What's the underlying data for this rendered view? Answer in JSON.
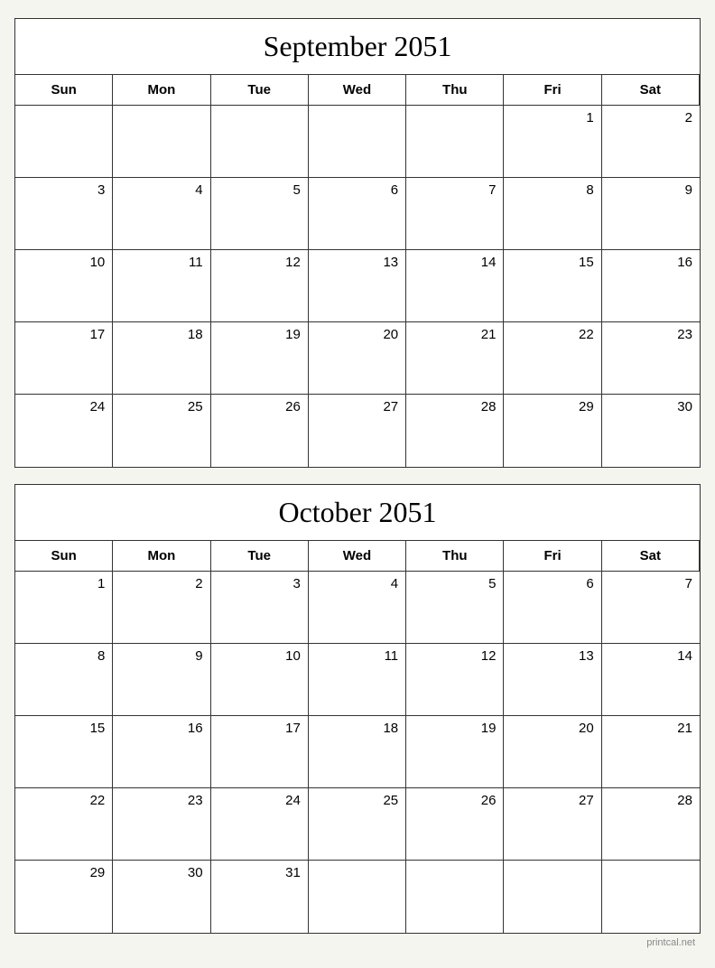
{
  "calendars": [
    {
      "id": "september-2051",
      "title": "September 2051",
      "headers": [
        "Sun",
        "Mon",
        "Tue",
        "Wed",
        "Thu",
        "Fri",
        "Sat"
      ],
      "weeks": [
        [
          "",
          "",
          "",
          "",
          "",
          "1",
          "2"
        ],
        [
          "3",
          "4",
          "5",
          "6",
          "7",
          "8",
          "9"
        ],
        [
          "10",
          "11",
          "12",
          "13",
          "14",
          "15",
          "16"
        ],
        [
          "17",
          "18",
          "19",
          "20",
          "21",
          "22",
          "23"
        ],
        [
          "24",
          "25",
          "26",
          "27",
          "28",
          "29",
          "30"
        ]
      ]
    },
    {
      "id": "october-2051",
      "title": "October 2051",
      "headers": [
        "Sun",
        "Mon",
        "Tue",
        "Wed",
        "Thu",
        "Fri",
        "Sat"
      ],
      "weeks": [
        [
          "1",
          "2",
          "3",
          "4",
          "5",
          "6",
          "7"
        ],
        [
          "8",
          "9",
          "10",
          "11",
          "12",
          "13",
          "14"
        ],
        [
          "15",
          "16",
          "17",
          "18",
          "19",
          "20",
          "21"
        ],
        [
          "22",
          "23",
          "24",
          "25",
          "26",
          "27",
          "28"
        ],
        [
          "29",
          "30",
          "31",
          "",
          "",
          "",
          ""
        ]
      ]
    }
  ],
  "watermark": "printcal.net"
}
